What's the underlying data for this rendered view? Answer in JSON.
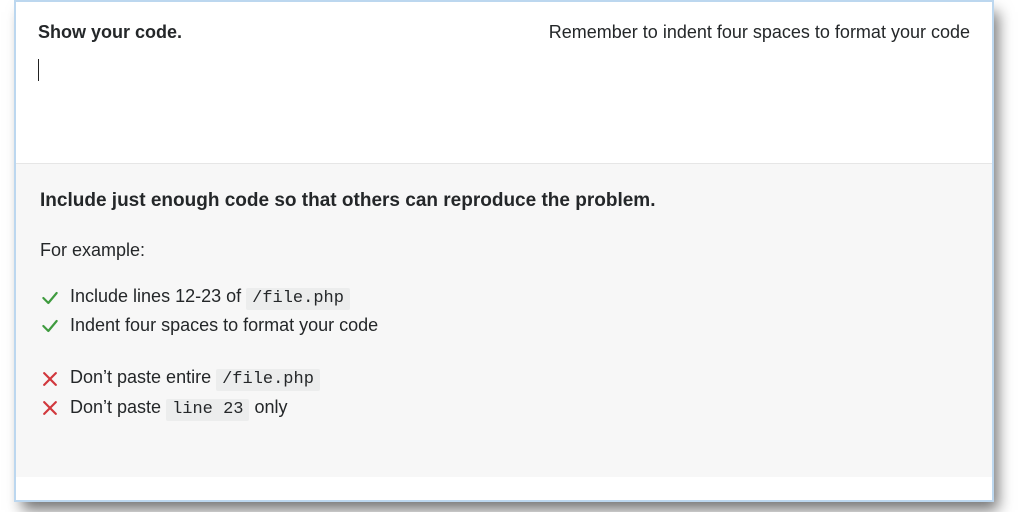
{
  "header": {
    "title": "Show your code.",
    "hint": "Remember to indent four spaces to format your code"
  },
  "input": {
    "value": ""
  },
  "guidance": {
    "headline": "Include just enough code so that others can reproduce the problem.",
    "example_label": "For example:",
    "good": [
      {
        "prefix": "Include lines 12-23 of ",
        "code": "/file.php",
        "suffix": ""
      },
      {
        "prefix": "Indent four spaces to format your code",
        "code": "",
        "suffix": ""
      }
    ],
    "bad": [
      {
        "prefix": "Don’t paste entire ",
        "code": "/file.php",
        "suffix": ""
      },
      {
        "prefix": "Don’t paste ",
        "code": "line 23",
        "suffix": " only"
      }
    ]
  },
  "icons": {
    "check": "check-icon",
    "cross": "cross-icon"
  }
}
